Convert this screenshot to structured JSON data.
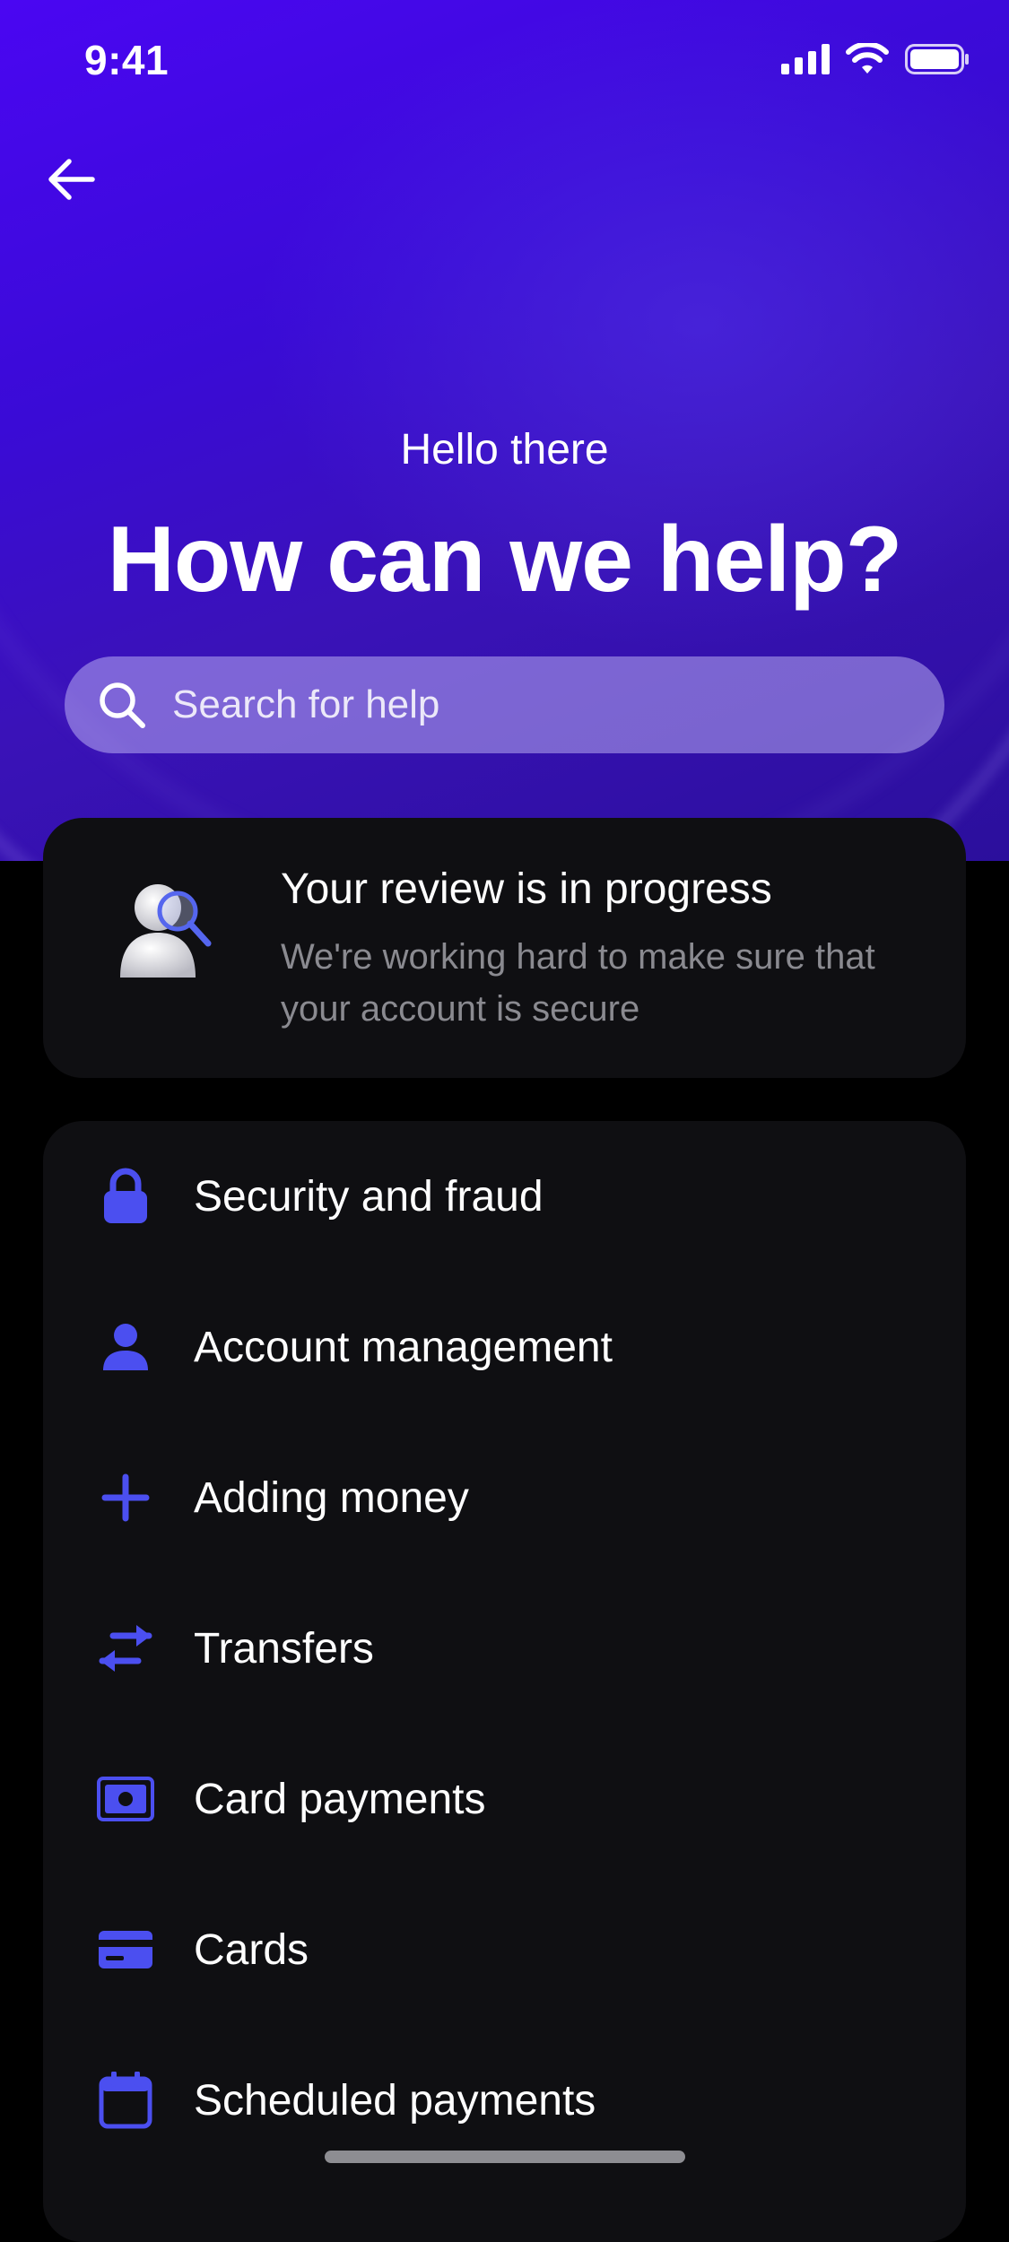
{
  "status_bar": {
    "time": "9:41"
  },
  "header": {
    "greeting": "Hello there",
    "headline": "How can we help?"
  },
  "search": {
    "placeholder": "Search for help"
  },
  "review_card": {
    "title": "Your review is in progress",
    "subtitle": "We're working hard to make sure that your account is secure"
  },
  "menu": {
    "items": [
      {
        "label": "Security and fraud",
        "icon": "lock-icon"
      },
      {
        "label": "Account management",
        "icon": "person-icon"
      },
      {
        "label": "Adding money",
        "icon": "plus-icon"
      },
      {
        "label": "Transfers",
        "icon": "transfer-arrows-icon"
      },
      {
        "label": "Card payments",
        "icon": "banknote-icon"
      },
      {
        "label": "Cards",
        "icon": "card-icon"
      },
      {
        "label": "Scheduled payments",
        "icon": "calendar-icon"
      }
    ]
  },
  "colors": {
    "accent": "#4b4ff0",
    "hero_top": "#4a06f2",
    "card_bg": "#0f0f12",
    "muted_text": "#8a8a90"
  }
}
